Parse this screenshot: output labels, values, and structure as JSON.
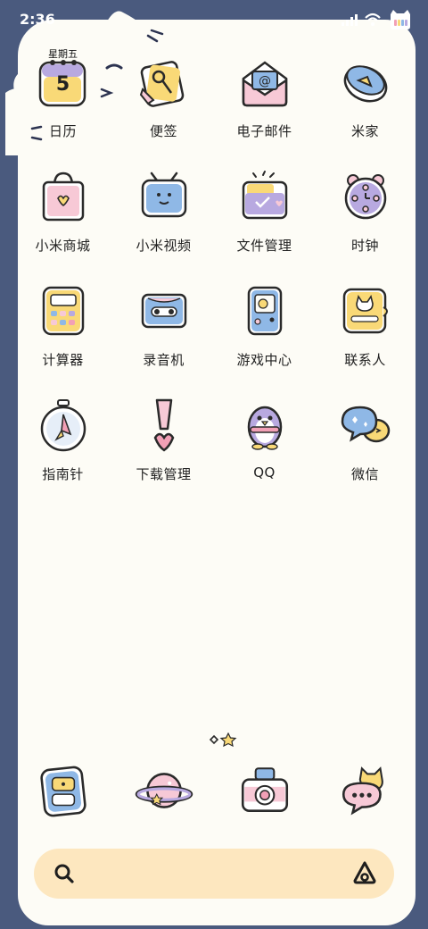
{
  "status_bar": {
    "time": "2:36",
    "icons": [
      "signal-icon",
      "wifi-icon",
      "battery-cat-icon"
    ]
  },
  "apps": [
    {
      "name": "calendar",
      "label": "日历",
      "icon": "calendar-icon",
      "weekday": "星期五",
      "day": "5"
    },
    {
      "name": "notes",
      "label": "便签",
      "icon": "notes-icon"
    },
    {
      "name": "email",
      "label": "电子邮件",
      "icon": "email-icon"
    },
    {
      "name": "mi-home",
      "label": "米家",
      "icon": "mi-home-icon"
    },
    {
      "name": "mi-store",
      "label": "小米商城",
      "icon": "shopping-bag-icon"
    },
    {
      "name": "mi-video",
      "label": "小米视频",
      "icon": "tv-icon"
    },
    {
      "name": "file-manager",
      "label": "文件管理",
      "icon": "folder-icon"
    },
    {
      "name": "clock",
      "label": "时钟",
      "icon": "alarm-clock-icon"
    },
    {
      "name": "calculator",
      "label": "计算器",
      "icon": "calculator-icon"
    },
    {
      "name": "recorder",
      "label": "录音机",
      "icon": "cassette-icon"
    },
    {
      "name": "game-center",
      "label": "游戏中心",
      "icon": "gameboy-icon"
    },
    {
      "name": "contacts",
      "label": "联系人",
      "icon": "contacts-cat-icon"
    },
    {
      "name": "compass",
      "label": "指南针",
      "icon": "compass-icon"
    },
    {
      "name": "downloads",
      "label": "下载管理",
      "icon": "exclamation-heart-icon"
    },
    {
      "name": "qq",
      "label": "QQ",
      "icon": "penguin-icon"
    },
    {
      "name": "wechat",
      "label": "微信",
      "icon": "chat-bubbles-icon"
    }
  ],
  "dock": [
    {
      "name": "phone",
      "icon": "phone-icon"
    },
    {
      "name": "browser",
      "icon": "planet-icon"
    },
    {
      "name": "camera",
      "icon": "camera-icon"
    },
    {
      "name": "messages",
      "icon": "messages-cat-icon"
    }
  ],
  "colors": {
    "wallpaper": "#4a5a7e",
    "panel": "#fdfcf6",
    "search_bar": "#fde7bf",
    "pink": "#f7c9d6",
    "blue": "#8fb8e6",
    "yellow": "#f9d977",
    "purple": "#b8a9e0"
  }
}
